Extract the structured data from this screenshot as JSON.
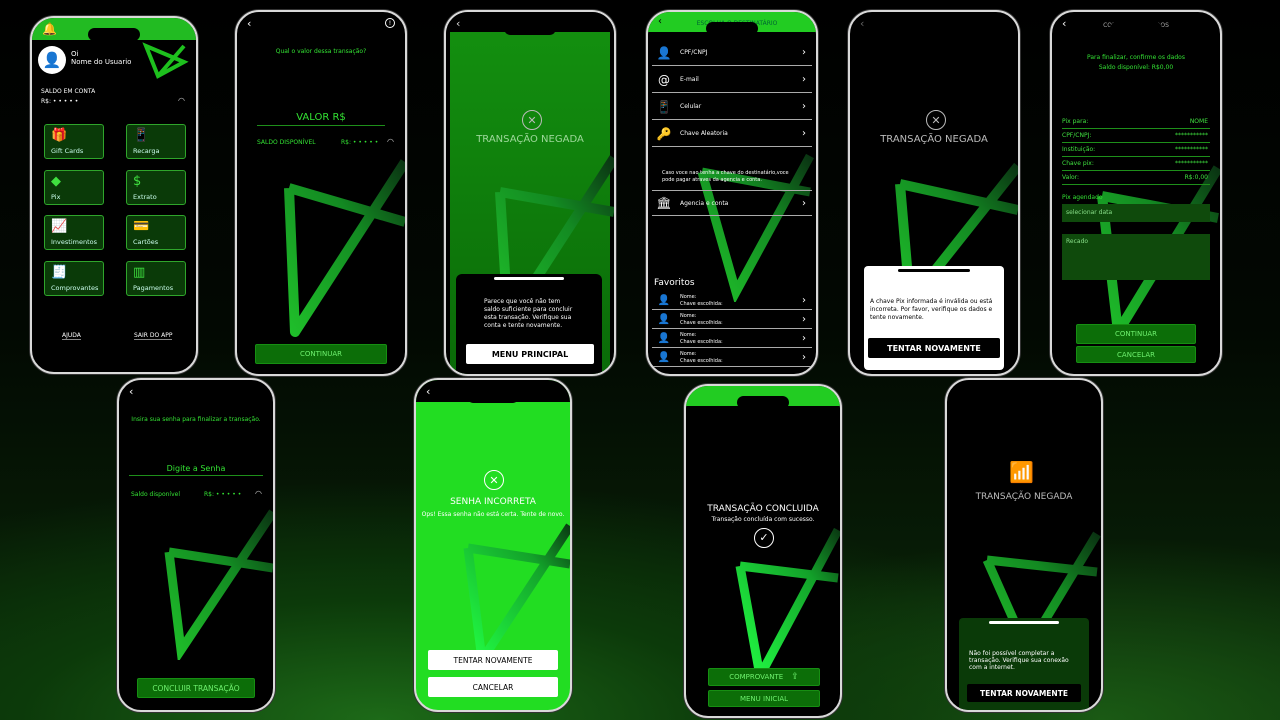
{
  "screens": {
    "home": {
      "greeting": "Oi",
      "user_name": "Nome do Usuario",
      "balance_label": "SALDO EM CONTA",
      "balance_value": "R$: • • • • •",
      "tiles": [
        {
          "label": "Gift Cards",
          "icon": "🎁"
        },
        {
          "label": "Recarga",
          "icon": "📱"
        },
        {
          "label": "Pix",
          "icon": "◆"
        },
        {
          "label": "Extrato",
          "icon": "$"
        },
        {
          "label": "Investimentos",
          "icon": "📈"
        },
        {
          "label": "Cartões",
          "icon": "💳"
        },
        {
          "label": "Comprovantes",
          "icon": "🧾"
        },
        {
          "label": "Pagamentos",
          "icon": "▥"
        }
      ],
      "help": "AJUDA",
      "exit": "SAIR DO APP"
    },
    "value": {
      "question": "Qual o valor dessa transação?",
      "value_placeholder": "VALOR R$",
      "available_label": "SALDO DISPONÍVEL",
      "available_value": "R$: • • • • •",
      "continue": "CONTINUAR"
    },
    "denied1": {
      "title": "TRANSAÇÃO NEGADA",
      "message": "Parece que você não tem saldo suficiente para concluir esta transação. Verifique sua conta e tente novamente.",
      "button": "MENU PRINCIPAL"
    },
    "recipient": {
      "header": "ESCOLHA O DESTINATÁRIO",
      "options": [
        {
          "label": "CPF/CNPJ",
          "icon": "👤"
        },
        {
          "label": "E-mail",
          "icon": "@"
        },
        {
          "label": "Celular",
          "icon": "📱"
        },
        {
          "label": "Chave Aleatoria",
          "icon": "🔑"
        }
      ],
      "info": "Caso voce nao tenha a chave do destinatário,voce pode pagar atraves da agencia e conta.",
      "agency": "Agencia e conta",
      "favorites_title": "Favoritos",
      "favorites": [
        {
          "name": "Nome:",
          "key": "Chave escolhida:"
        },
        {
          "name": "Nome:",
          "key": "Chave escolhida:"
        },
        {
          "name": "Nome:",
          "key": "Chave escolhida:"
        },
        {
          "name": "Nome:",
          "key": "Chave escolhida:"
        }
      ]
    },
    "denied2": {
      "title": "TRANSAÇÃO NEGADA",
      "message": "A chave Pix informada é inválida ou está incorreta. Por favor, verifique os dados e tente novamente.",
      "button": "TENTAR NOVAMENTE"
    },
    "confirm": {
      "header": "CONFIRME OS DADOS",
      "intro": "Para finalizar, confirme os dados",
      "available": "Saldo disponível: R$0,00",
      "fields": [
        {
          "label": "Pix para:",
          "value": "NOME"
        },
        {
          "label": "CPF/CNPJ:",
          "value": "***********"
        },
        {
          "label": "Instituição:",
          "value": "***********"
        },
        {
          "label": "Chave pix:",
          "value": "***********"
        },
        {
          "label": "Valor:",
          "value": "R$:0,00"
        }
      ],
      "scheduled_label": "Pix agendado",
      "date_placeholder": "selecionar data",
      "note_placeholder": "Recado",
      "continue": "CONTINUAR",
      "cancel": "CANCELAR"
    },
    "password": {
      "prompt": "Insira sua senha para finalizar a transação.",
      "placeholder": "Digite a Senha",
      "available_label": "Saldo disponível",
      "available_value": "R$: • • • • •",
      "button": "CONCLUIR TRANSAÇÃO"
    },
    "wrong_password": {
      "title": "SENHA INCORRETA",
      "message": "Ops! Essa senha não está certa. Tente de novo.",
      "retry": "TENTAR NOVAMENTE",
      "cancel": "CANCELAR"
    },
    "success": {
      "title": "TRANSAÇÃO CONCLUIDA",
      "subtitle": "Transação concluída com sucesso.",
      "receipt": "COMPROVANTE",
      "home": "MENU INICIAL"
    },
    "denied3": {
      "title": "TRANSAÇÃO NEGADA",
      "message": "Não foi possível completar a transação. Verifique sua conexão com a internet.",
      "button": "TENTAR NOVAMENTE"
    }
  },
  "colors": {
    "accent": "#33e233",
    "dark_green": "#0c6e08",
    "bright_green": "#22dd22"
  }
}
